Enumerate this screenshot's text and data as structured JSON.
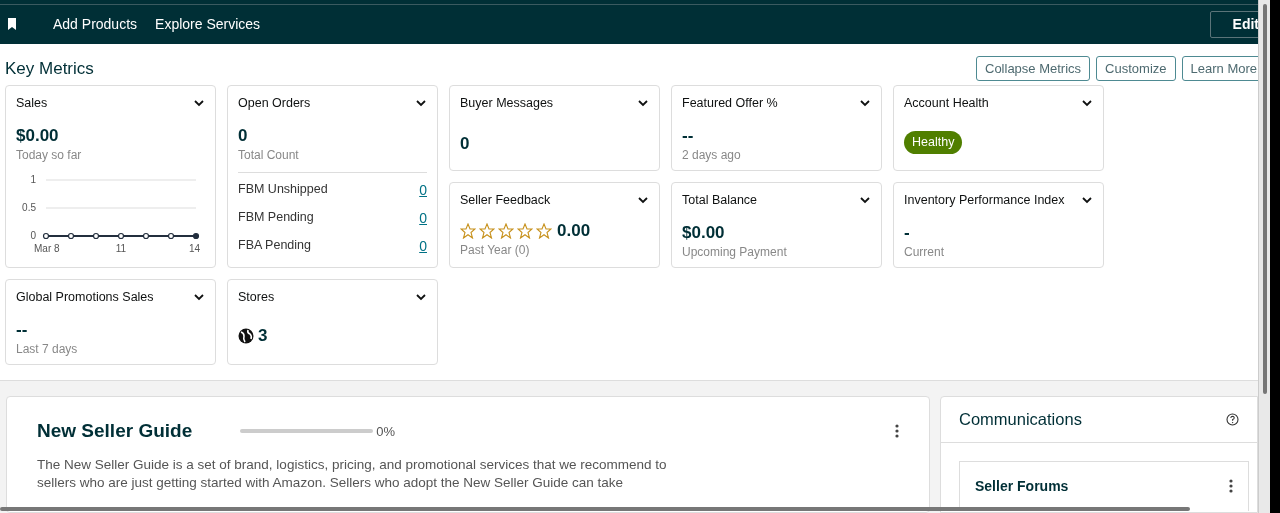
{
  "nav": {
    "links": [
      "Add Products",
      "Explore Services"
    ],
    "edit_button": "Edit"
  },
  "key_metrics": {
    "title": "Key Metrics",
    "buttons": [
      "Collapse Metrics",
      "Customize",
      "Learn More"
    ],
    "cards": [
      {
        "kind": "chart",
        "title": "Sales",
        "value": "$0.00",
        "caption": "Today so far",
        "chart_data": {
          "type": "line",
          "x": [
            8,
            9,
            10,
            11,
            12,
            13,
            14
          ],
          "xticks": [
            {
              "value": 8,
              "label": "Mar 8"
            },
            {
              "value": 11,
              "label": "11"
            },
            {
              "value": 14,
              "label": "14"
            }
          ],
          "xlim": [
            8,
            14
          ],
          "yticks": [
            0,
            0.5,
            1
          ],
          "ylim": [
            0,
            1
          ],
          "series": [
            {
              "marker": "circle",
              "color": "#232f3e",
              "values": [
                0,
                0,
                0,
                0,
                0,
                0,
                0
              ]
            }
          ]
        }
      },
      {
        "kind": "breakdown",
        "title": "Open Orders",
        "value": "0",
        "caption": "Total Count",
        "rows": [
          {
            "label": "FBM Unshipped",
            "value": "0"
          },
          {
            "label": "FBM Pending",
            "value": "0"
          },
          {
            "label": "FBA Pending",
            "value": "0"
          }
        ]
      },
      {
        "kind": "value",
        "title": "Buyer Messages",
        "value": "0"
      },
      {
        "kind": "value",
        "title": "Featured Offer %",
        "value": "--",
        "caption": "2 days ago"
      },
      {
        "kind": "badge",
        "title": "Account Health",
        "badge": "Healthy"
      },
      {
        "kind": "stars",
        "title": "Seller Feedback",
        "stars": 0,
        "value": "0.00",
        "caption": "Past Year (0)"
      },
      {
        "kind": "value",
        "title": "Total Balance",
        "value": "$0.00",
        "caption": "Upcoming Payment"
      },
      {
        "kind": "value",
        "title": "Inventory Performance Index",
        "value": "-",
        "caption": "Current"
      },
      {
        "kind": "value",
        "title": "Global Promotions Sales",
        "value": "--",
        "caption": "Last 7 days"
      },
      {
        "kind": "globe",
        "title": "Stores",
        "value": "3"
      }
    ]
  },
  "guide": {
    "title": "New Seller Guide",
    "level": 0,
    "reading": "0%",
    "text": "The New Seller Guide is a set of brand, logistics, pricing, and promotional services that we recommend to sellers who are just getting started with Amazon. Sellers who adopt the New Seller Guide can take"
  },
  "communications": {
    "title": "Communications",
    "items": [
      {
        "title": "Seller Forums"
      }
    ]
  }
}
